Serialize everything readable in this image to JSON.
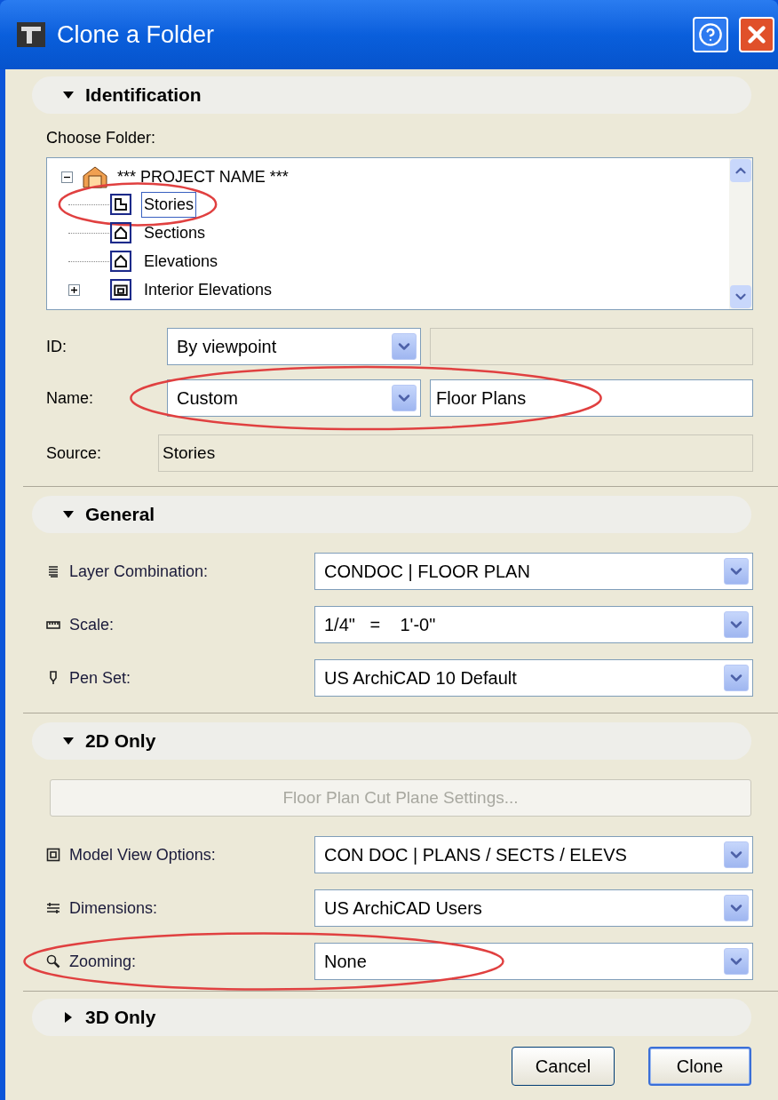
{
  "window": {
    "title": "Clone a Folder"
  },
  "identification": {
    "header": {
      "label": "Identification",
      "expanded": true
    },
    "choose_folder_label": "Choose Folder:",
    "tree": {
      "label": "*** PROJECT NAME ***",
      "expanded": true,
      "children": [
        {
          "label": "Stories",
          "kind": "story",
          "selected": true,
          "circled": true
        },
        {
          "label": "Sections",
          "kind": "house",
          "selected": false,
          "circled": false
        },
        {
          "label": "Elevations",
          "kind": "house",
          "selected": false,
          "circled": false
        },
        {
          "label": "Interior Elevations",
          "kind": "interior",
          "selected": false,
          "circled": false,
          "expanded": false
        }
      ]
    },
    "id": {
      "label": "ID:",
      "dropdown": "By viewpoint",
      "circled": false
    },
    "name": {
      "label": "Name:",
      "dropdown": "Custom",
      "value": "Floor Plans",
      "circled": true
    },
    "source": {
      "label": "Source:",
      "value": "Stories"
    }
  },
  "general": {
    "header": {
      "label": "General",
      "expanded": true
    },
    "rows": [
      {
        "kind": "layers",
        "label": "Layer Combination:",
        "value": "CONDOC | FLOOR PLAN",
        "circled": false
      },
      {
        "kind": "scale",
        "label": "Scale:",
        "value": "1/4\"   =    1'-0\"",
        "circled": false
      },
      {
        "kind": "pen",
        "label": "Pen Set:",
        "value": "US ArchiCAD 10 Default",
        "circled": false
      }
    ]
  },
  "two_d_only": {
    "header": {
      "label": "2D Only",
      "expanded": true
    },
    "button": {
      "label": "Floor Plan Cut Plane Settings...",
      "disabled": true
    },
    "rows": [
      {
        "kind": "model",
        "label": "Model View Options:",
        "value": "CON DOC | PLANS / SECTS / ELEVS",
        "circled": false
      },
      {
        "kind": "dimensions",
        "label": "Dimensions:",
        "value": "US ArchiCAD Users",
        "circled": false
      },
      {
        "kind": "zoom",
        "label": "Zooming:",
        "value": "None",
        "circled": true
      }
    ]
  },
  "three_d_only": {
    "header": {
      "label": "3D Only",
      "expanded": false
    }
  },
  "buttons": [
    {
      "label": "Cancel",
      "default": false
    },
    {
      "label": "Clone",
      "default": true
    }
  ]
}
